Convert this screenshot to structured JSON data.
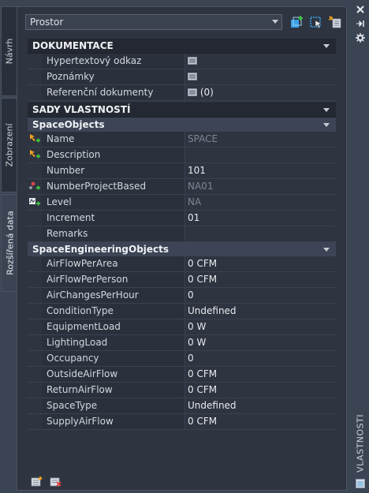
{
  "left_tabs": [
    {
      "label": "Návrh"
    },
    {
      "label": "Zobrazení"
    },
    {
      "label": "Rozšířená data"
    }
  ],
  "toolbar": {
    "object_type": "Prostor",
    "icons": [
      "add-object-icon",
      "select-objects-icon",
      "quick-select-icon"
    ]
  },
  "sections": {
    "documentation": {
      "title": "DOKUMENTACE",
      "rows": [
        {
          "label": "Hypertextový odkaz",
          "value": ""
        },
        {
          "label": "Poznámky",
          "value": ""
        },
        {
          "label": "Referenční dokumenty",
          "value": "(0)"
        }
      ]
    },
    "property_sets": {
      "title": "SADY VLASTNOSTÍ",
      "space_objects": {
        "title": "SpaceObjects",
        "rows": [
          {
            "label": "Name",
            "value": "SPACE"
          },
          {
            "label": "Description",
            "value": ""
          },
          {
            "label": "Number",
            "value": "101"
          },
          {
            "label": "NumberProjectBased",
            "value": "NA01"
          },
          {
            "label": "Level",
            "value": "NA"
          },
          {
            "label": "Increment",
            "value": "01"
          },
          {
            "label": "Remarks",
            "value": ""
          }
        ]
      },
      "space_engineering": {
        "title": "SpaceEngineeringObjects",
        "rows": [
          {
            "label": "AirFlowPerArea",
            "value": "0 CFM"
          },
          {
            "label": "AirFlowPerPerson",
            "value": "0 CFM"
          },
          {
            "label": "AirChangesPerHour",
            "value": "0"
          },
          {
            "label": "ConditionType",
            "value": "Undefined"
          },
          {
            "label": "EquipmentLoad",
            "value": "0 W"
          },
          {
            "label": "LightingLoad",
            "value": "0 W"
          },
          {
            "label": "Occupancy",
            "value": "0"
          },
          {
            "label": "OutsideAirFlow",
            "value": "0 CFM"
          },
          {
            "label": "ReturnAirFlow",
            "value": "0 CFM"
          },
          {
            "label": "SpaceType",
            "value": "Undefined"
          },
          {
            "label": "SupplyAirFlow",
            "value": "0 CFM"
          }
        ]
      }
    }
  },
  "palette_title": "VLASTNOSTI",
  "colors": {
    "background": "#3b4453",
    "panel": "#2e3440",
    "section_header": "#232832",
    "subsection_header": "#3c4455",
    "label_cell": "#2b313c",
    "dim_value": "#7f8796",
    "icon_orange": "#f0a020",
    "icon_green": "#3fbf3f",
    "icon_blue": "#3aa0e6"
  }
}
